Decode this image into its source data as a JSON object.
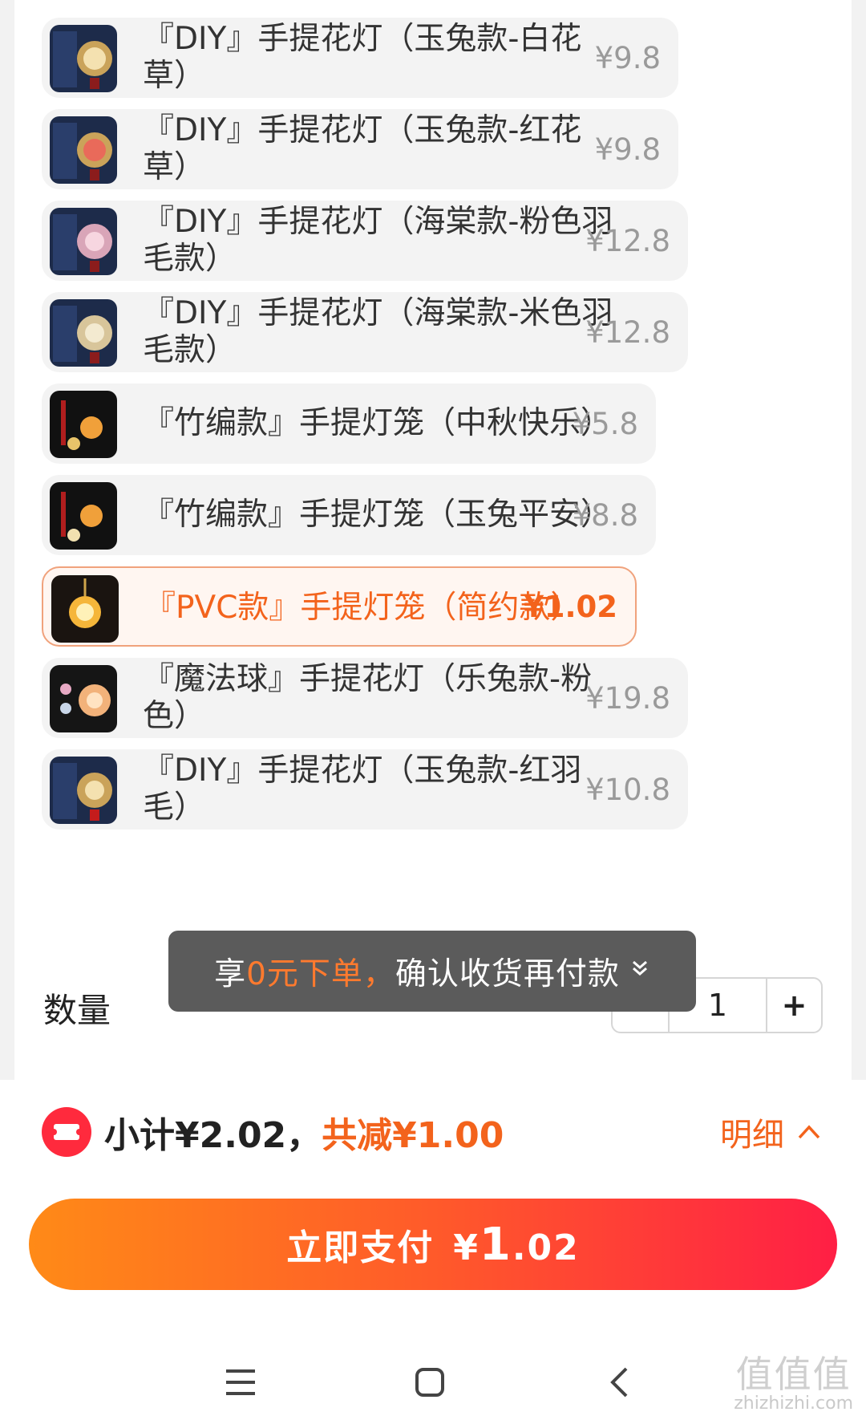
{
  "options": [
    {
      "name_line1": "『DIY』手提花灯（玉兔款-白花",
      "name_line2": "草）",
      "price": "¥9.8",
      "thumb": "rabbit-lantern-white"
    },
    {
      "name_line1": "『DIY』手提花灯（玉兔款-红花",
      "name_line2": "草）",
      "price": "¥9.8",
      "thumb": "rabbit-lantern-red"
    },
    {
      "name_line1": "『DIY』手提花灯（海棠款-粉色羽",
      "name_line2": "毛款）",
      "price": "¥12.8",
      "thumb": "begonia-lantern-pink"
    },
    {
      "name_line1": "『DIY』手提花灯（海棠款-米色羽",
      "name_line2": "毛款）",
      "price": "¥12.8",
      "thumb": "begonia-lantern-beige"
    },
    {
      "name_line1": "『竹编款』手提灯笼（中秋快乐）",
      "name_line2": "",
      "price": "¥5.8",
      "thumb": "bamboo-lantern"
    },
    {
      "name_line1": "『竹编款』手提灯笼（玉兔平安）",
      "name_line2": "",
      "price": "¥8.8",
      "thumb": "bamboo-lantern-rabbit"
    },
    {
      "name_line1": "『PVC款』手提灯笼（简约款）",
      "name_line2": "",
      "price": "¥1.02",
      "thumb": "pvc-lantern",
      "selected": true
    },
    {
      "name_line1": "『魔法球』手提花灯（乐兔款-粉",
      "name_line2": "色）",
      "price": "¥19.8",
      "thumb": "magic-ball-lantern"
    },
    {
      "name_line1": "『DIY』手提花灯（玉兔款-红羽",
      "name_line2": "毛）",
      "price": "¥10.8",
      "thumb": "rabbit-lantern-feather"
    }
  ],
  "quantity": {
    "label": "数量",
    "value": "1",
    "minus": "-",
    "plus": "+"
  },
  "toast": {
    "prefix": "享",
    "highlight": "0元下单，",
    "suffix": "确认收货再付款",
    "chevron": "»"
  },
  "footer": {
    "subtotal": "小计¥2.02，",
    "saved": "共减¥1.00",
    "detail": "明细",
    "pay_label": "立即支付",
    "pay_currency": "¥",
    "pay_int": "1",
    "pay_dec": ".02"
  },
  "watermark": {
    "big": "值值值",
    "small": "zhizhizhi.com"
  },
  "colors": {
    "accent": "#f3631c",
    "pay_start": "#ff8a17",
    "pay_end": "#ff1f45",
    "coupon": "#ff2a3d"
  }
}
